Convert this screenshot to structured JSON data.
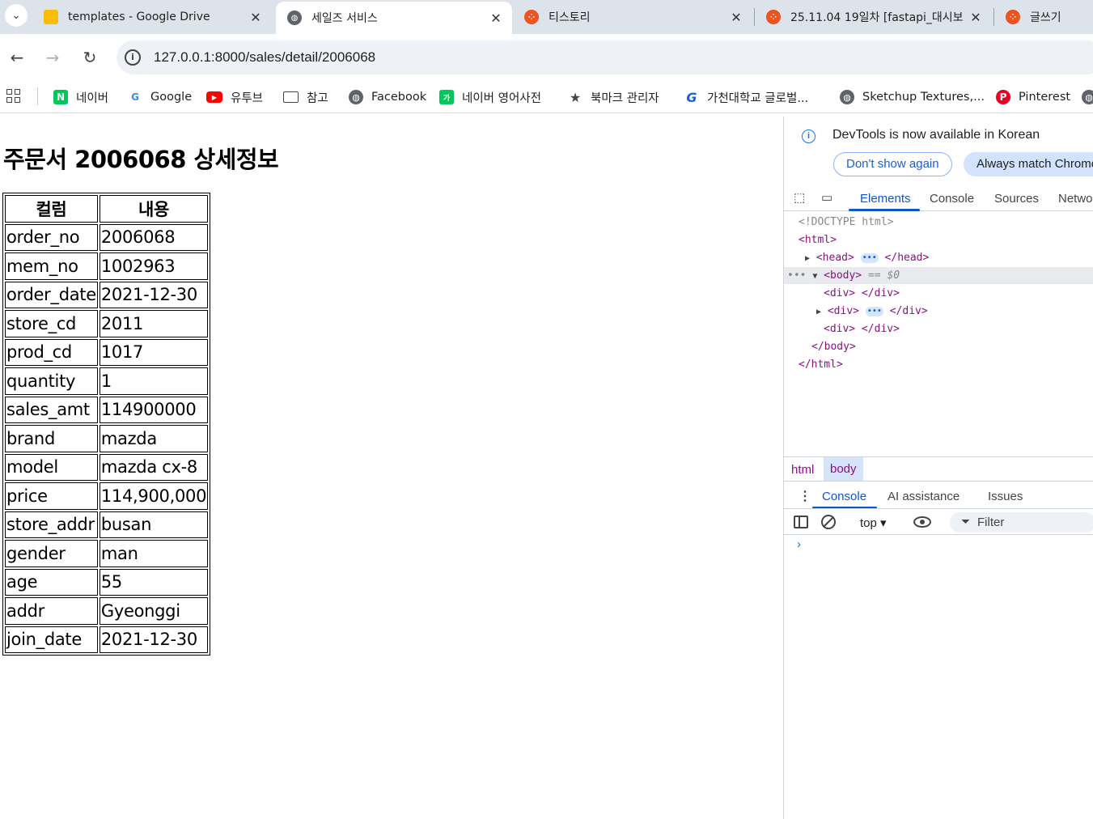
{
  "browser": {
    "tabs": [
      {
        "label": "templates - Google Drive",
        "icon": "google-drive-icon",
        "color": "#1e8e3e"
      },
      {
        "label": "세일즈 서비스",
        "icon": "globe-icon",
        "color": "#5f6368"
      },
      {
        "label": "티스토리",
        "icon": "tistory-icon",
        "color": "#eb531f"
      },
      {
        "label": "25.11.04 19일차 [fastapi_대시보",
        "icon": "tistory-icon",
        "color": "#eb531f"
      },
      {
        "label": "글쓰기",
        "icon": "tistory-icon",
        "color": "#eb531f"
      }
    ],
    "url": "127.0.0.1:8000/sales/detail/2006068",
    "bookmarks": [
      {
        "label": "네이버",
        "icon": "naver-icon",
        "glyph": "N",
        "color": "#03c75a"
      },
      {
        "label": "Google",
        "icon": "google-icon",
        "glyph": "G",
        "color": "#4285f4"
      },
      {
        "label": "유투브",
        "icon": "youtube-icon",
        "glyph": "▶",
        "color": "#ff0000"
      },
      {
        "label": "참고",
        "icon": "folder-icon",
        "glyph": "▭",
        "color": "#444444"
      },
      {
        "label": "Facebook",
        "icon": "globe-icon",
        "glyph": "◍",
        "color": "#5f6368"
      },
      {
        "label": "네이버 영어사전",
        "icon": "naver-dictionary-icon",
        "glyph": "가",
        "color": "#03c75a"
      },
      {
        "label": "북마크 관리자",
        "icon": "star-icon",
        "glyph": "★",
        "color": "#444444"
      },
      {
        "label": "가천대학교 글로벌...",
        "icon": "gachon-icon",
        "glyph": "G",
        "color": "#1a5fd0"
      },
      {
        "label": "Sketchup Textures,...",
        "icon": "globe-icon",
        "glyph": "◍",
        "color": "#5f6368"
      },
      {
        "label": "Pinterest",
        "icon": "pinterest-icon",
        "glyph": "P",
        "color": "#e60023"
      }
    ]
  },
  "page": {
    "title": "주문서 2006068 상세정보",
    "table": {
      "headers": [
        "컬럼",
        "내용"
      ],
      "rows": [
        [
          "order_no",
          "2006068"
        ],
        [
          "mem_no",
          "1002963"
        ],
        [
          "order_date",
          "2021-12-30"
        ],
        [
          "store_cd",
          "2011"
        ],
        [
          "prod_cd",
          "1017"
        ],
        [
          "quantity",
          "1"
        ],
        [
          "sales_amt",
          "114900000"
        ],
        [
          "brand",
          "mazda"
        ],
        [
          "model",
          "mazda cx-8"
        ],
        [
          "price",
          "114,900,000"
        ],
        [
          "store_addr",
          "busan"
        ],
        [
          "gender",
          "man"
        ],
        [
          "age",
          "55"
        ],
        [
          "addr",
          "Gyeonggi"
        ],
        [
          "join_date",
          "2021-12-30"
        ]
      ]
    }
  },
  "devtools": {
    "info_text": "DevTools is now available in Korean",
    "dont_show_label": "Don't show again",
    "always_match_label": "Always match Chrome",
    "tabs": [
      "Elements",
      "Console",
      "Sources",
      "Network"
    ],
    "code": {
      "doctype": "<!DOCTYPE html>",
      "html_open": "<html>",
      "head": "<head>",
      "head_close": "</head>",
      "body": "<body>",
      "body_eq": "== $0",
      "div_open": "<div>",
      "div_close": "</div>",
      "body_close": "</body>",
      "html_close": "</html>"
    },
    "breadcrumbs": [
      "html",
      "body"
    ],
    "drawer_tabs": [
      "Console",
      "AI assistance",
      "Issues"
    ],
    "context": "top ▾",
    "filter_placeholder": "Filter"
  }
}
